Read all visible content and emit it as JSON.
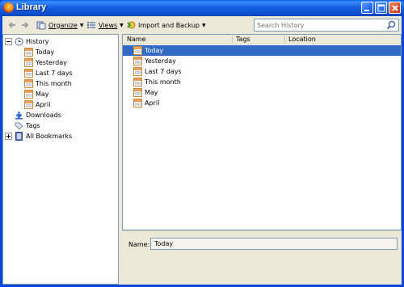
{
  "window": {
    "title": "Library"
  },
  "toolbar": {
    "back_icon": "back-arrow-icon",
    "forward_icon": "forward-arrow-icon",
    "organize_label": "Organize",
    "views_label": "Views",
    "import_label": "Import and Backup",
    "search_placeholder": "Search History"
  },
  "tree": {
    "items": [
      {
        "label": "History",
        "icon": "clock-icon",
        "expanded": true
      },
      {
        "label": "Today",
        "icon": "calendar-icon"
      },
      {
        "label": "Yesterday",
        "icon": "calendar-icon"
      },
      {
        "label": "Last 7 days",
        "icon": "calendar-icon"
      },
      {
        "label": "This month",
        "icon": "calendar-icon"
      },
      {
        "label": "May",
        "icon": "calendar-icon"
      },
      {
        "label": "April",
        "icon": "calendar-icon"
      },
      {
        "label": "Downloads",
        "icon": "download-arrow-icon"
      },
      {
        "label": "Tags",
        "icon": "tag-icon"
      },
      {
        "label": "All Bookmarks",
        "icon": "bookmarks-icon",
        "expanded": false
      }
    ]
  },
  "list": {
    "columns": [
      "Name",
      "Tags",
      "Location"
    ],
    "rows": [
      {
        "name": "Today",
        "selected": true
      },
      {
        "name": "Yesterday"
      },
      {
        "name": "Last 7 days"
      },
      {
        "name": "This month"
      },
      {
        "name": "May"
      },
      {
        "name": "April"
      }
    ]
  },
  "details": {
    "name_label": "Name:",
    "name_value": "Today"
  },
  "colors": {
    "title_bar": "#0a5ee8",
    "selection": "#316ac5",
    "close_button": "#e0522a"
  }
}
